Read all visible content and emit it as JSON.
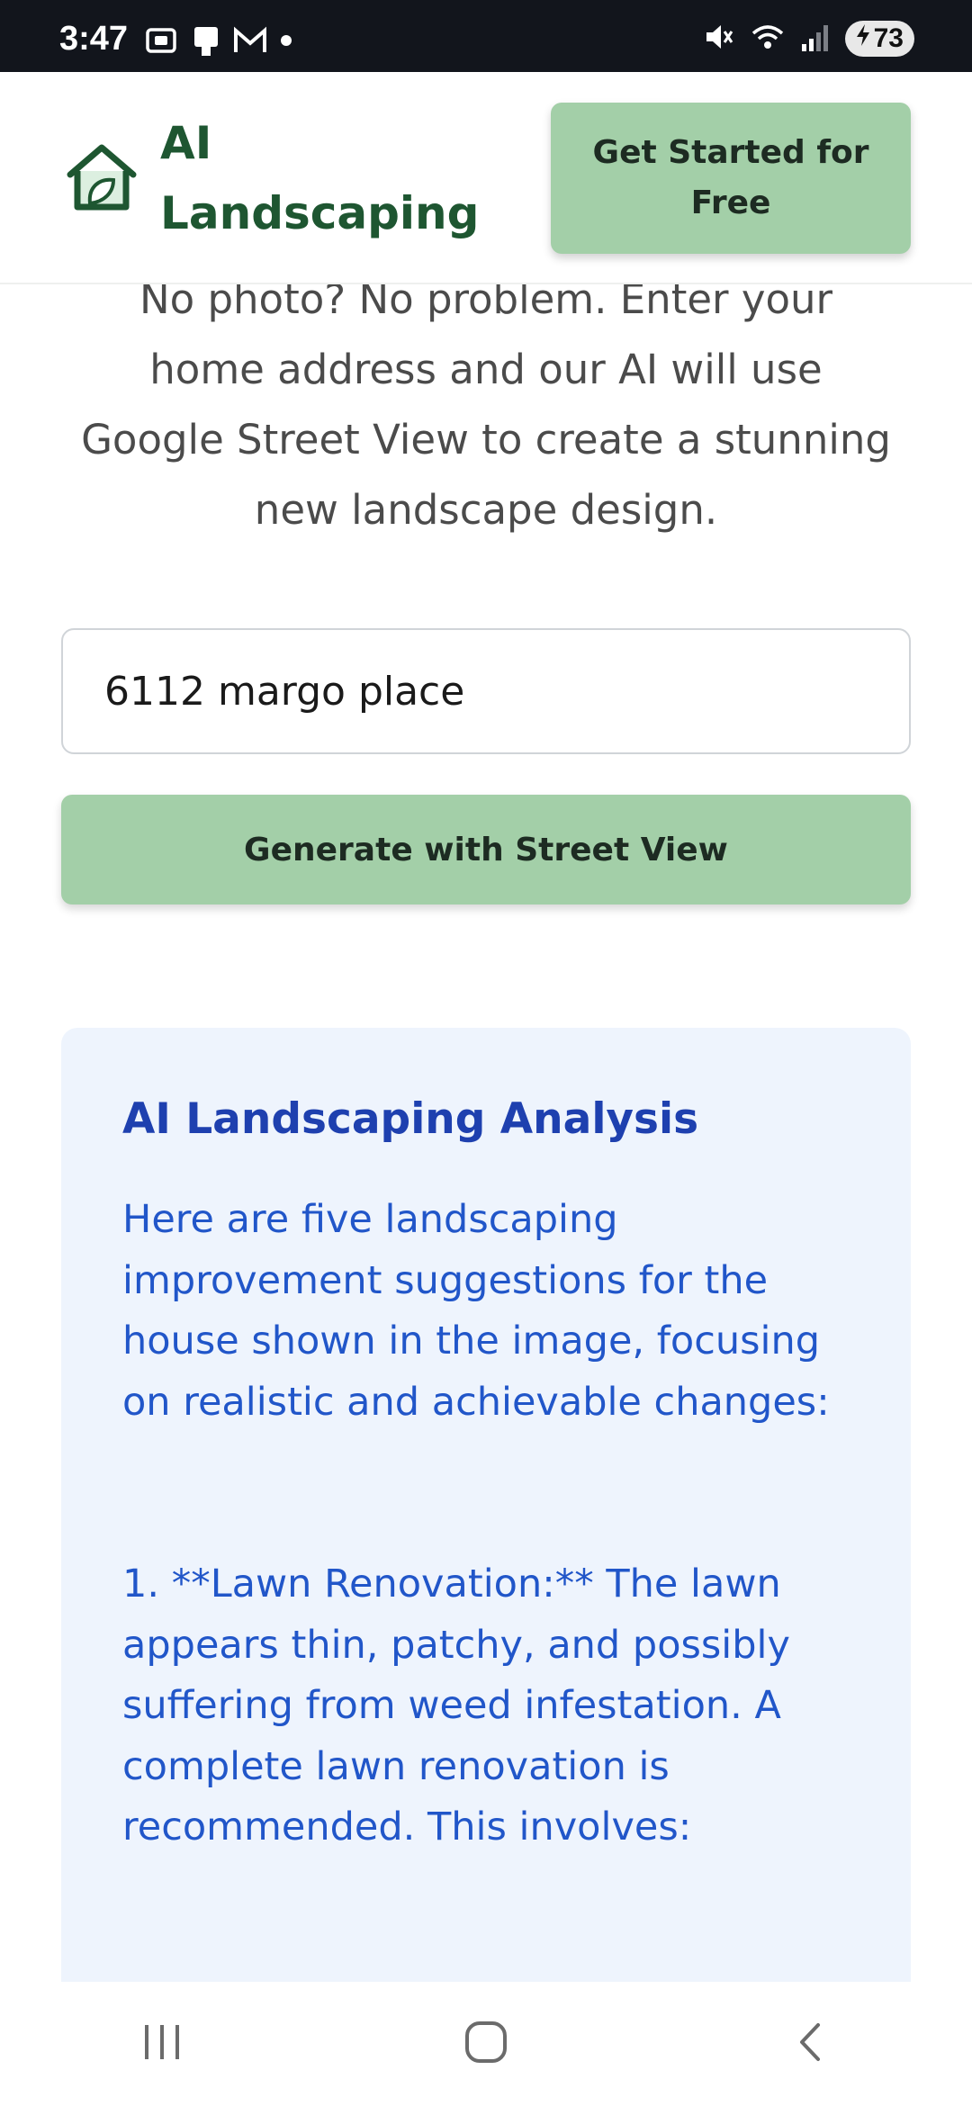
{
  "status_bar": {
    "time": "3:47",
    "battery": "73",
    "icons": [
      "screenshot-icon",
      "clipboard-icon",
      "gmail-icon",
      "dot-icon",
      "mute-icon",
      "wifi-icon",
      "signal-icon",
      "battery-charging-icon"
    ]
  },
  "header": {
    "app_name": "AI Landscaping",
    "logo_icon": "house-leaf-icon",
    "cta_label": "Get Started for Free",
    "brand_color": "#1e5631",
    "button_color": "#a3cfa8"
  },
  "main": {
    "intro_text": "No photo? No problem. Enter your home address and our AI will use Google Street View to create a stunning new landscape design.",
    "address_value": "6112 margo place",
    "generate_label": "Generate with Street View"
  },
  "analysis": {
    "title": "AI Landscaping Analysis",
    "body": "Here are five landscaping improvement suggestions for the house shown in the image, focusing on realistic and achievable changes:\n\n\n1. **Lawn Renovation:** The lawn appears thin, patchy, and possibly suffering from weed infestation.  A complete lawn renovation is recommended. This involves:",
    "background_color": "#eef4fd",
    "text_color": "#2156c9"
  },
  "nav_bar": {
    "icons": [
      "recent-apps-icon",
      "home-icon",
      "back-icon"
    ]
  }
}
